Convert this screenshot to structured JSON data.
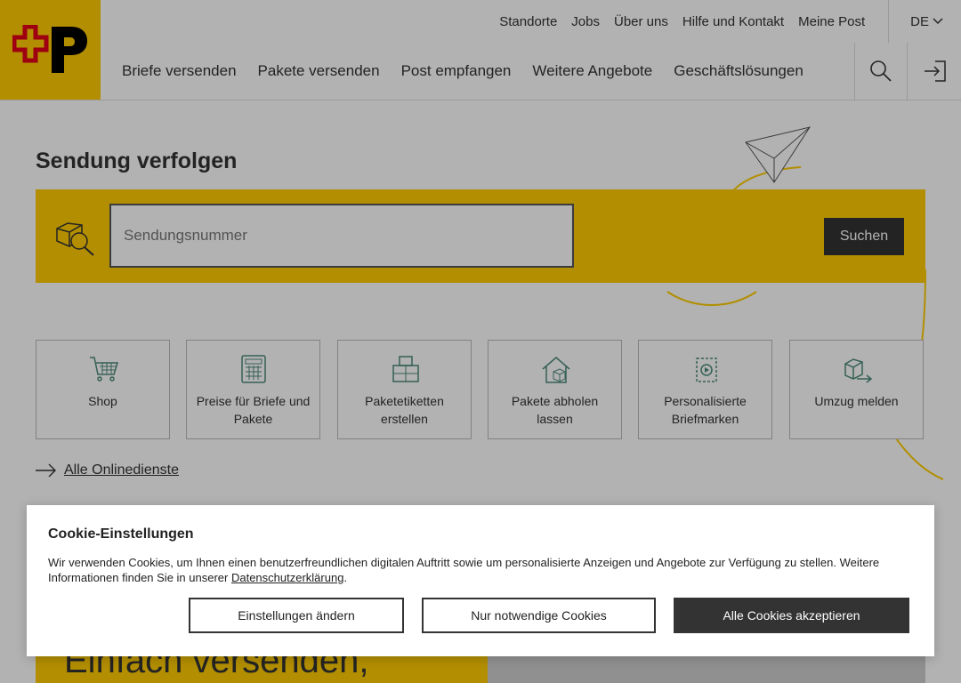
{
  "brand": {
    "logo_name": "Die Post",
    "accent_color": "#ffcc00",
    "logo_red": "#e3001b"
  },
  "metanav": [
    "Standorte",
    "Jobs",
    "Über uns",
    "Hilfe und Kontakt",
    "Meine Post"
  ],
  "language": "DE",
  "mainnav": [
    "Briefe versenden",
    "Pakete versenden",
    "Post empfangen",
    "Weitere Angebote",
    "Geschäftslösungen"
  ],
  "header_icons": [
    "search-icon",
    "login-icon"
  ],
  "tracking": {
    "title": "Sendung verfolgen",
    "placeholder": "Sendungsnummer",
    "button": "Suchen"
  },
  "tiles": [
    {
      "label": "Shop",
      "icon": "shopping-cart-icon"
    },
    {
      "label": "Preise für Briefe und Pakete",
      "icon": "calculator-icon"
    },
    {
      "label": "Paketetiketten erstellen",
      "icon": "parcel-label-icon"
    },
    {
      "label": "Pakete abholen lassen",
      "icon": "parcel-pickup-icon"
    },
    {
      "label": "Personalisierte Briefmarken",
      "icon": "stamp-icon"
    },
    {
      "label": "Umzug melden",
      "icon": "moving-icon"
    }
  ],
  "all_services": "Alle Onlinedienste",
  "promo_text": "Einfach versenden,",
  "cookie": {
    "title": "Cookie-Einstellungen",
    "text_before": "Wir verwenden Cookies, um Ihnen einen benutzerfreundlichen digitalen Auftritt sowie um personalisierte Anzeigen und Angebote zur Verfügung zu stellen. Weitere Informationen finden Sie in unserer ",
    "link": "Datenschutzerklärung",
    "text_after": ".",
    "btn_settings": "Einstellungen ändern",
    "btn_necessary": "Nur notwendige Cookies",
    "btn_accept_all": "Alle Cookies akzeptieren"
  }
}
